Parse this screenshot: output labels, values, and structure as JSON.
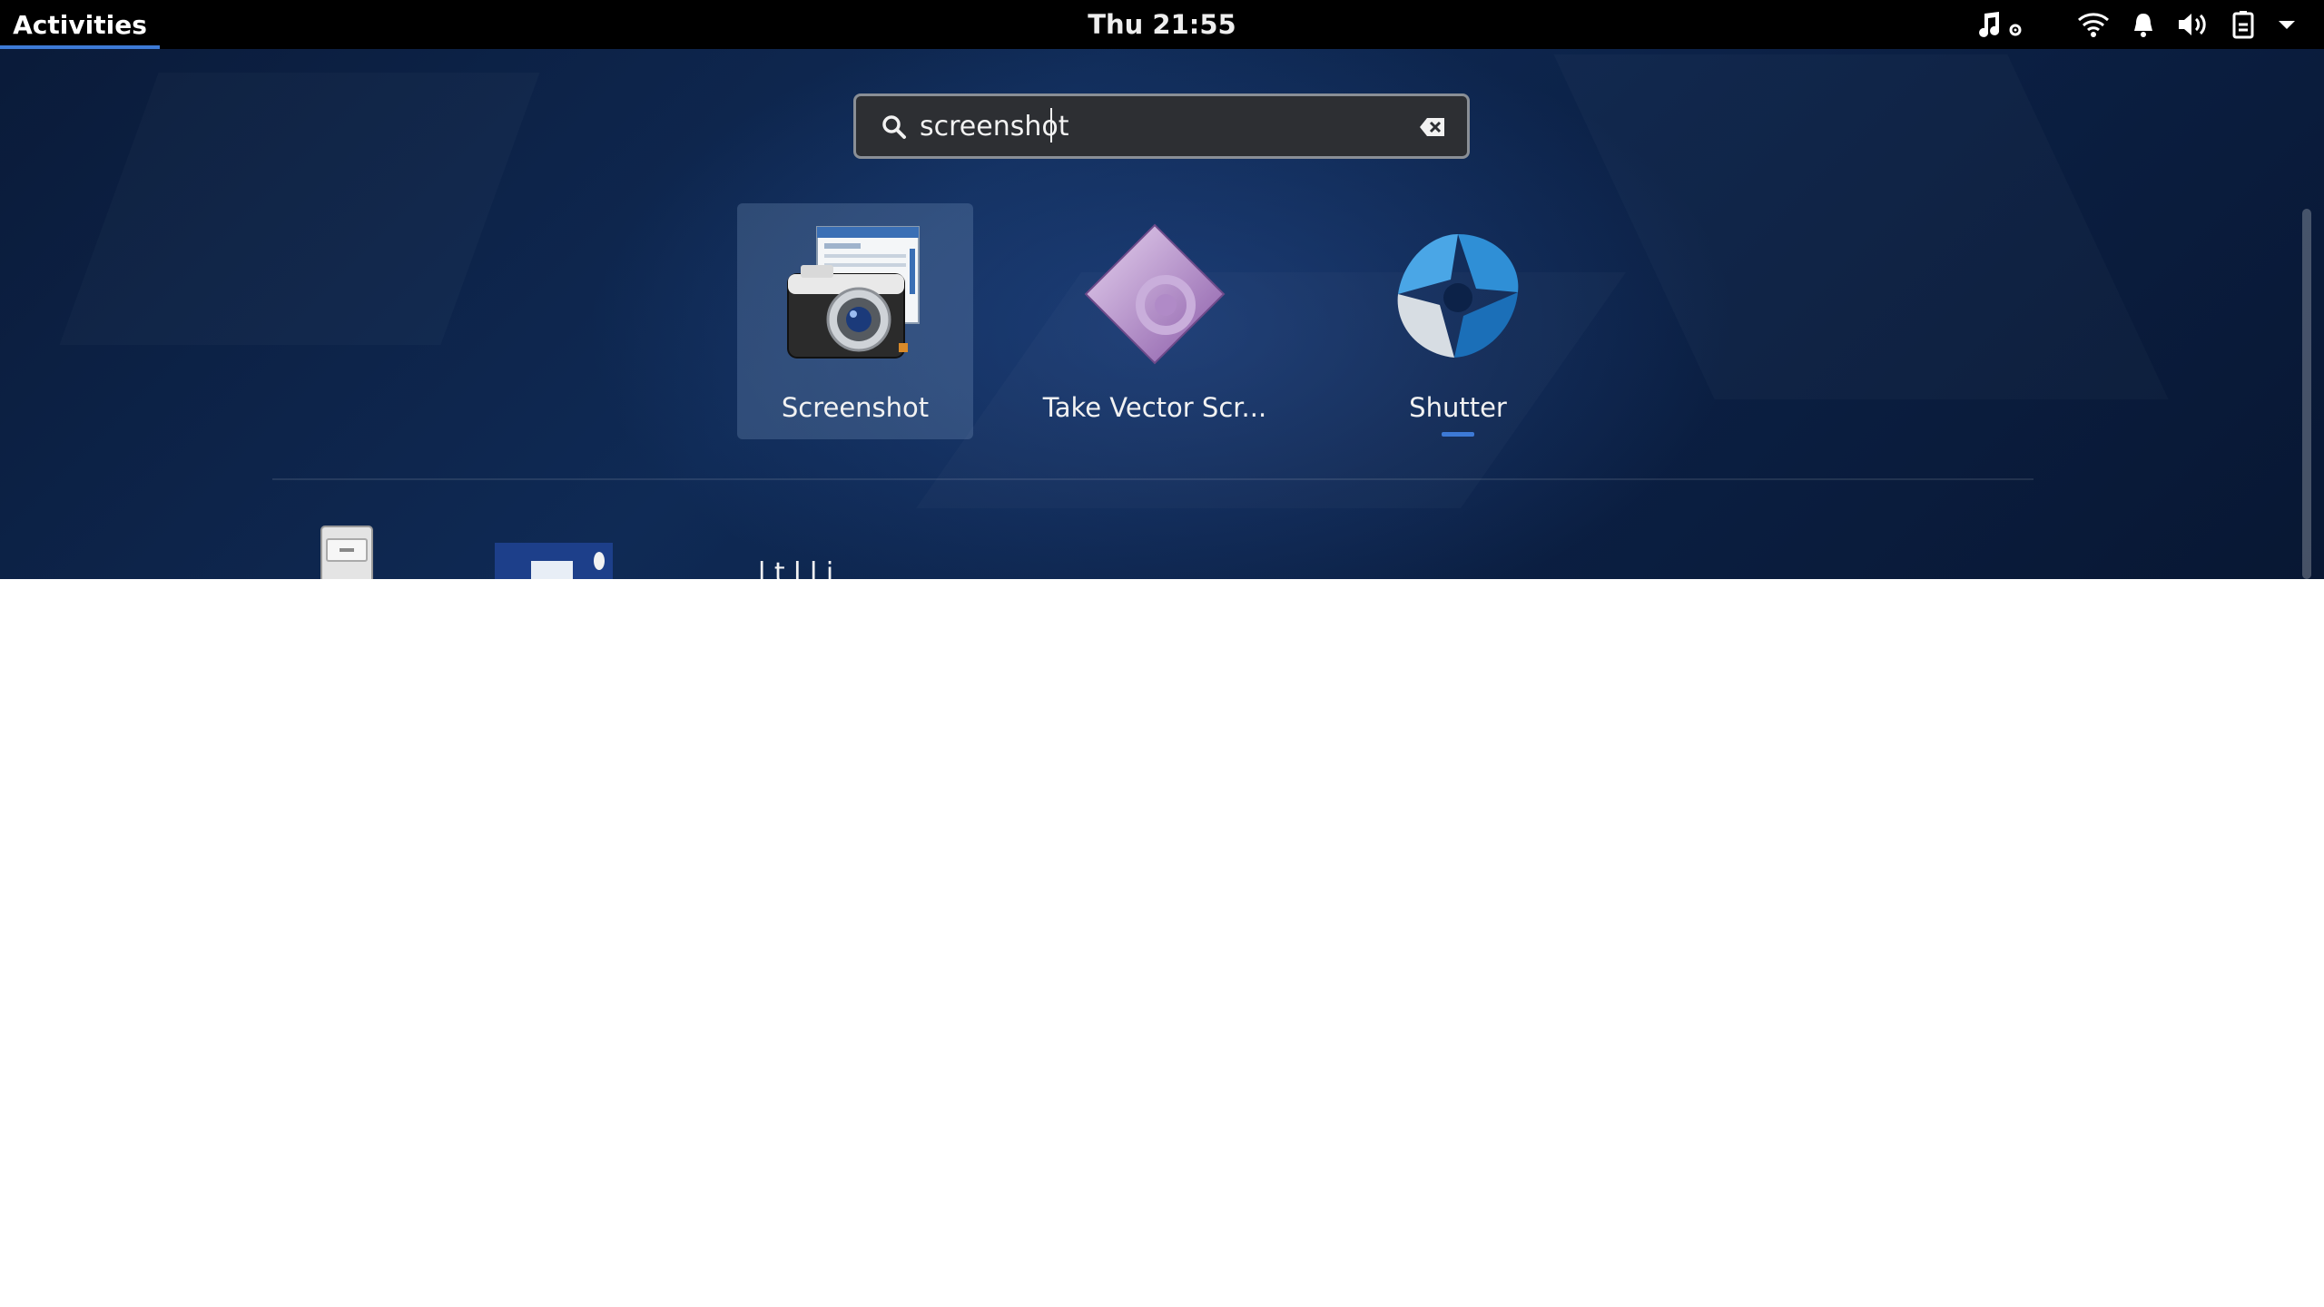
{
  "topbar": {
    "activities_label": "Activities",
    "clock": "Thu 21:55",
    "tray_icons": [
      "music-settings-icon",
      "wifi-icon",
      "notification-bell-icon",
      "volume-icon",
      "battery-icon",
      "chevron-down-icon"
    ]
  },
  "search": {
    "value": "screenshot",
    "icon": "search-icon",
    "clear_icon": "clear-text-icon"
  },
  "results": [
    {
      "label": "Screenshot",
      "icon": "camera-screenshot-icon",
      "selected": true
    },
    {
      "label": "Take Vector Scr...",
      "icon": "vector-screenshot-icon",
      "selected": false
    },
    {
      "label": "Shutter",
      "icon": "shutter-aperture-icon",
      "running": true
    }
  ],
  "second_row": {
    "partial_text": "l  t l l  i"
  },
  "colors": {
    "accent": "#3d7ad6",
    "topbar": "#000000",
    "search_bg": "#2d2f33"
  }
}
